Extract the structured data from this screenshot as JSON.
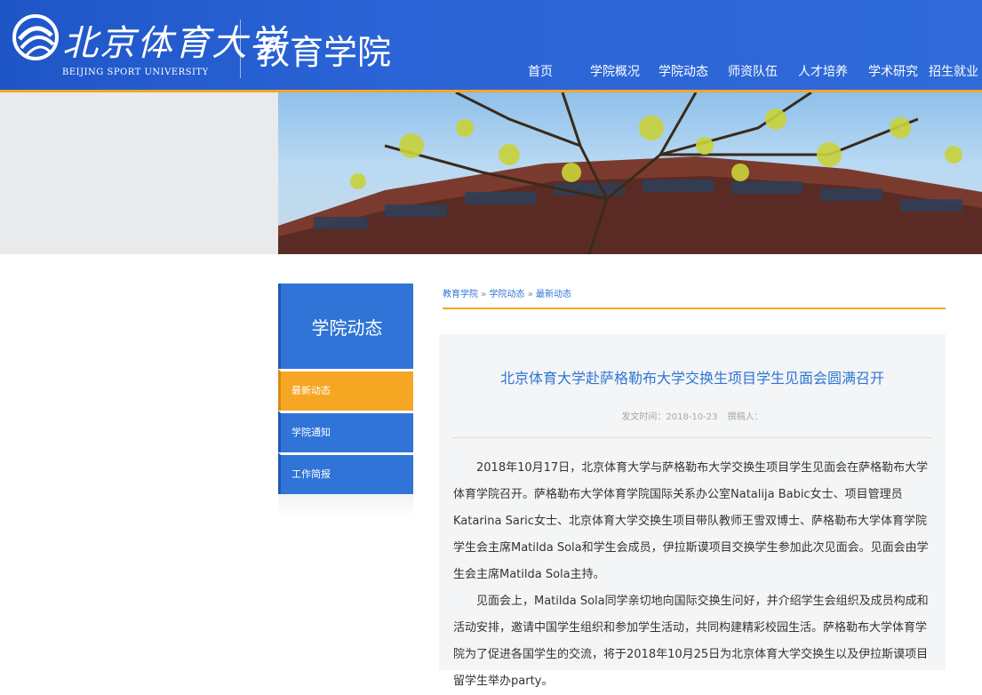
{
  "header": {
    "logo_cn": "北京体育大学",
    "logo_en": "BEIJING SPORT UNIVERSITY",
    "college": "教育学院",
    "nav": [
      "首页",
      "学院概况",
      "学院动态",
      "师资队伍",
      "人才培养",
      "学术研究",
      "招生就业"
    ]
  },
  "sidebar": {
    "title": "学院动态",
    "items": [
      {
        "label": "最新动态",
        "active": true
      },
      {
        "label": "学院通知",
        "active": false
      },
      {
        "label": "工作简报",
        "active": false
      }
    ]
  },
  "breadcrumb": [
    "教育学院",
    "学院动态",
    "最新动态"
  ],
  "breadcrumb_sep": "»",
  "article": {
    "title": "北京体育大学赴萨格勒布大学交换生项目学生见面会圆满召开",
    "meta_date": "发文时间：2018-10-23",
    "meta_author": "撰稿人：",
    "paragraphs": [
      "2018年10月17日，北京体育大学与萨格勒布大学交换生项目学生见面会在萨格勒布大学体育学院召开。萨格勒布大学体育学院国际关系办公室Natalija Babic女士、项目管理员Katarina Saric女士、北京体育大学交换生项目带队教师王雪双博士、萨格勒布大学体育学院学生会主席Matilda Sola和学生会成员，伊拉斯谟项目交换学生参加此次见面会。见面会由学生会主席Matilda Sola主持。",
      "见面会上，Matilda Sola同学亲切地向国际交换生问好，并介绍学生会组织及成员构成和活动安排，邀请中国学生组织和参加学生活动，共同构建精彩校园生活。萨格勒布大学体育学院为了促进各国学生的交流，将于2018年10月25日为北京体育大学交换生以及伊拉斯谟项目留学生举办party。"
    ]
  },
  "colors": {
    "header_blue": "#2b64d6",
    "accent_orange": "#f5a623",
    "sidebar_blue": "#2f74d6",
    "title_blue": "#2f74d6"
  }
}
